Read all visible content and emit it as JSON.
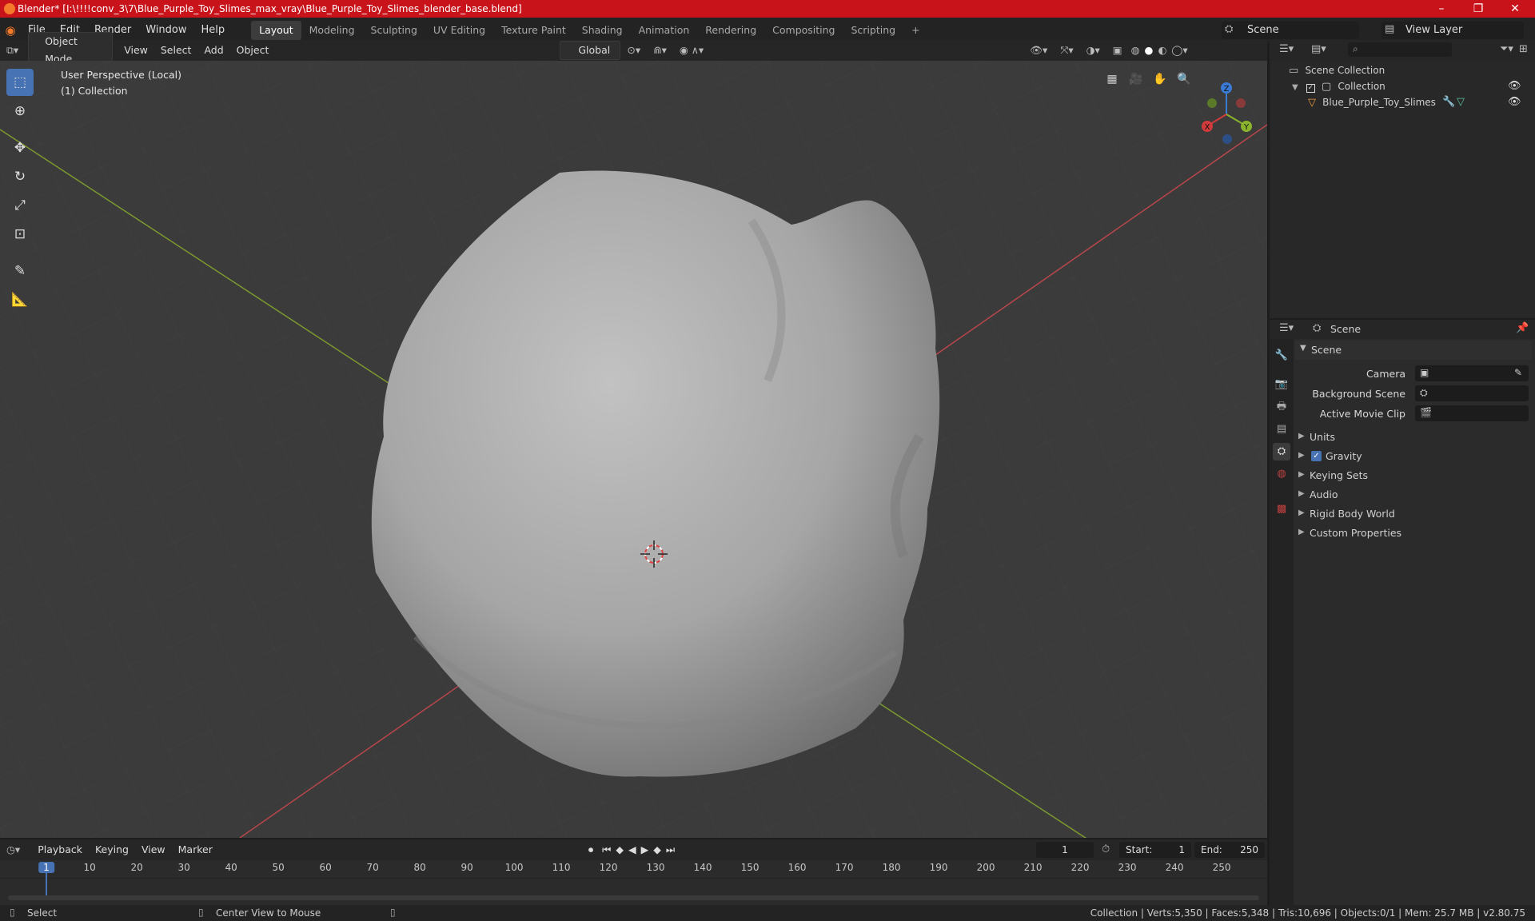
{
  "window": {
    "title": "Blender* [I:\\!!!!conv_3\\7\\Blue_Purple_Toy_Slimes_max_vray\\Blue_Purple_Toy_Slimes_blender_base.blend]",
    "minimize": "–",
    "maximize": "❐",
    "close": "✕"
  },
  "menus": [
    "File",
    "Edit",
    "Render",
    "Window",
    "Help"
  ],
  "workspaces": [
    "Layout",
    "Modeling",
    "Sculpting",
    "UV Editing",
    "Texture Paint",
    "Shading",
    "Animation",
    "Rendering",
    "Compositing",
    "Scripting"
  ],
  "workspace_add": "+",
  "scene_name": "Scene",
  "view_layer": "View Layer",
  "viewport_header": {
    "mode": "Object Mode",
    "view": "View",
    "select": "Select",
    "add": "Add",
    "object": "Object",
    "orientation": "Global"
  },
  "viewport": {
    "perspective": "User Perspective (Local)",
    "collection": "(1) Collection"
  },
  "gizmo": {
    "x": "X",
    "y": "Y",
    "z": "Z"
  },
  "outliner": {
    "root": "Scene Collection",
    "collection": "Collection",
    "object": "Blue_Purple_Toy_Slimes"
  },
  "properties": {
    "header": "Scene",
    "panel": "Scene",
    "camera_label": "Camera",
    "background_label": "Background Scene",
    "movie_clip_label": "Active Movie Clip",
    "sections": [
      "Units",
      "Gravity",
      "Keying Sets",
      "Audio",
      "Rigid Body World",
      "Custom Properties"
    ]
  },
  "timeline": {
    "playback": "Playback",
    "keying": "Keying",
    "view": "View",
    "marker": "Marker",
    "current_frame": "1",
    "start_label": "Start:",
    "start": "1",
    "end_label": "End:",
    "end": "250",
    "ticks": [
      "1",
      "10",
      "20",
      "30",
      "40",
      "50",
      "60",
      "70",
      "80",
      "90",
      "100",
      "110",
      "120",
      "130",
      "140",
      "150",
      "160",
      "170",
      "180",
      "190",
      "200",
      "210",
      "220",
      "230",
      "240",
      "250"
    ]
  },
  "status": {
    "select": "Select",
    "center": "Center View to Mouse",
    "stats": "Collection | Verts:5,350 | Faces:5,348 | Tris:10,696 | Objects:0/1 | Mem: 25.7 MB | v2.80.75"
  },
  "colors": {
    "title_bar": "#c8131b",
    "accent": "#4772b3",
    "x_axis": "#d23b3b",
    "y_axis": "#8bb42d",
    "z_axis": "#3a7bd5"
  }
}
